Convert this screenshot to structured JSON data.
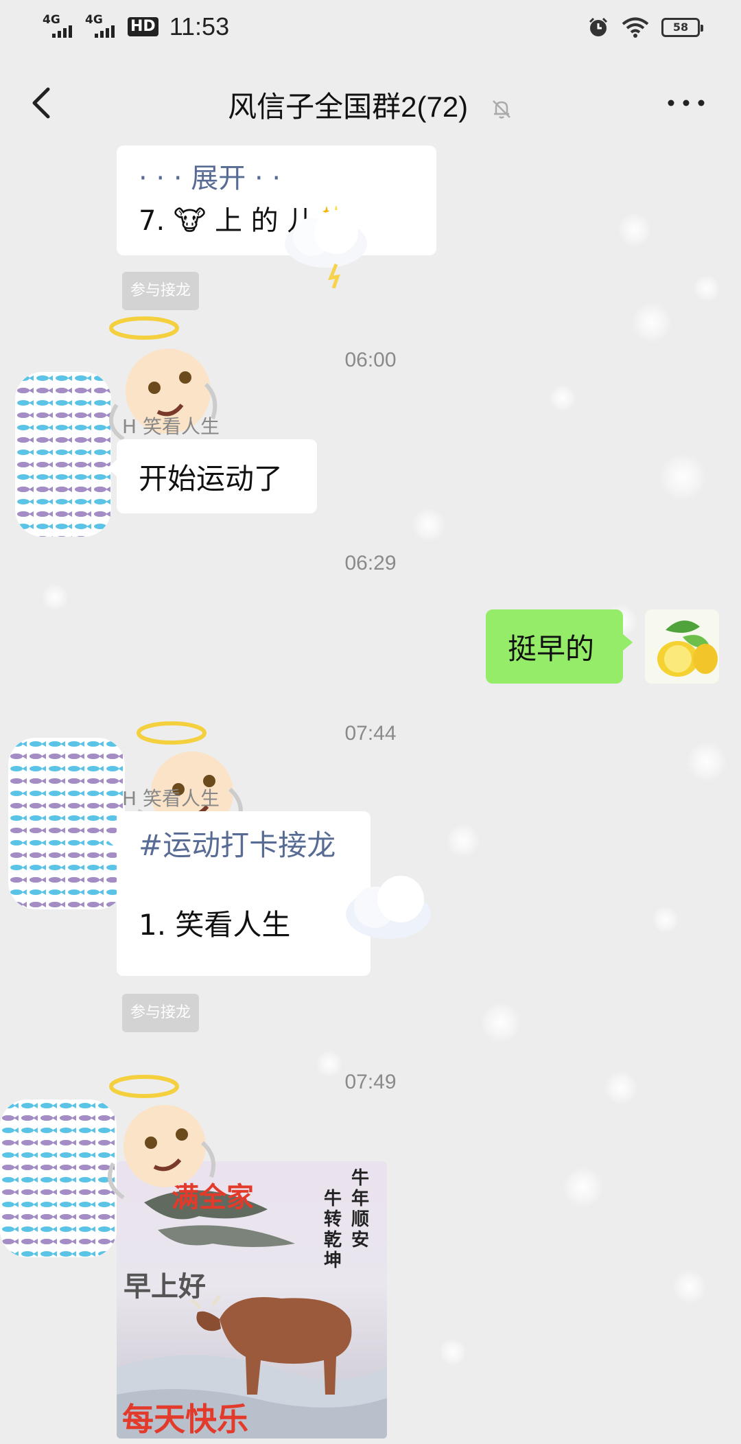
{
  "status_bar": {
    "signal1": "4G",
    "signal2": "4G",
    "hd": "HD",
    "time": "11:53",
    "battery": "58"
  },
  "header": {
    "title": "风信子全国群2(72)"
  },
  "messages": {
    "m1": {
      "line1": "· · · 展开 · ·",
      "line2": "7. 🐮 上   的   儿✨"
    },
    "chip_label": "参与接龙",
    "t1": "06:00",
    "m2": {
      "sender": "H   笑看人生",
      "text": "开始运动了"
    },
    "t2": "06:29",
    "m3": {
      "text": "挺早的"
    },
    "t3": "07:44",
    "m4": {
      "sender": "H   笑看人生",
      "line1": "#运动打卡接龙",
      "line2": "1. 笑看人生"
    },
    "chip2_label": "参与接龙",
    "t4": "07:49",
    "card": {
      "top": "满全家",
      "right1": "牛年顺安",
      "right2": "牛转乾坤",
      "mid": "早上好",
      "bottom": "每天快乐"
    }
  },
  "colors": {
    "background": "#ededed",
    "my_bubble": "#95ec69",
    "other_bubble": "#ffffff",
    "link_blue": "#576b95"
  }
}
